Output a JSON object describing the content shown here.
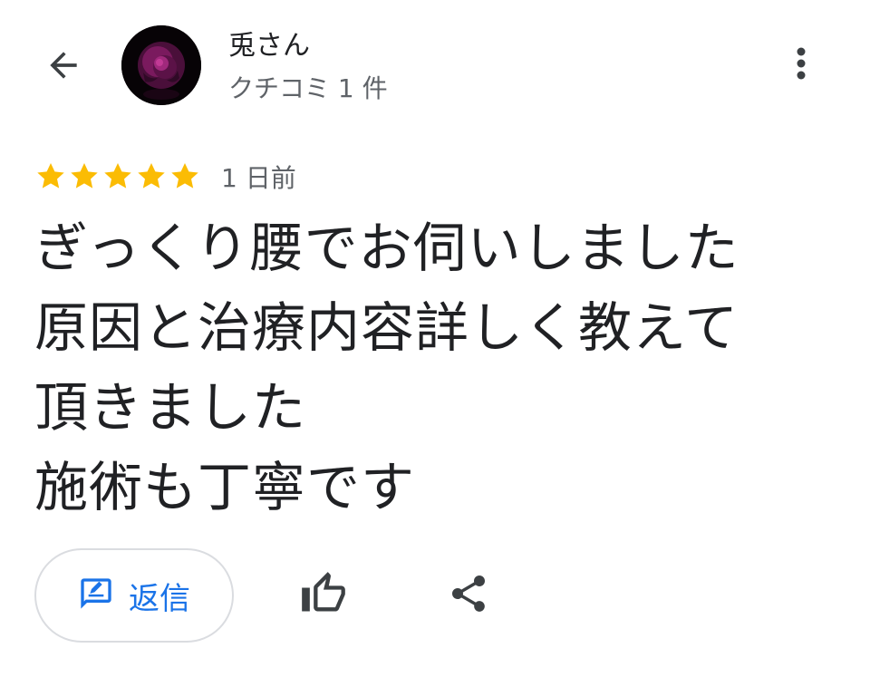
{
  "header": {
    "back_icon": "arrow-back-icon",
    "avatar_icon": "rose-avatar-image",
    "user_name": "兎さん",
    "review_count": "クチコミ 1 件",
    "more_icon": "more-vert-icon"
  },
  "review": {
    "rating": 5,
    "rating_max": 5,
    "star_color": "#fbbc04",
    "date": "1 日前",
    "lines": [
      "ぎっくり腰でお伺いしました",
      "原因と治療内容詳しく教えて",
      "頂きました",
      "施術も丁寧です"
    ]
  },
  "actions": {
    "reply_label": "返信",
    "reply_icon": "reply-edit-icon",
    "like_icon": "thumb-up-icon",
    "share_icon": "share-icon",
    "accent_color": "#1a73e8"
  }
}
